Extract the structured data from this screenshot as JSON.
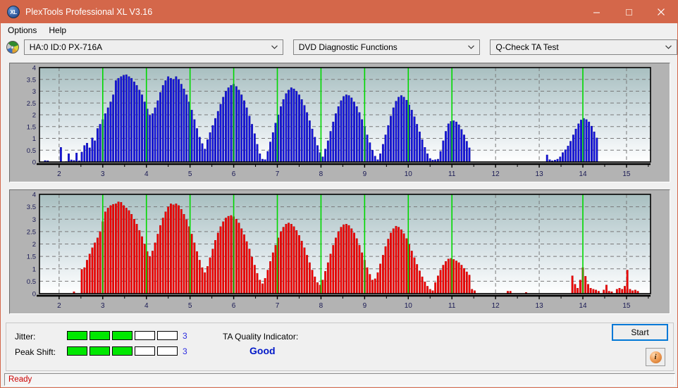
{
  "window": {
    "title": "PlexTools Professional XL V3.16",
    "icon": "XL",
    "accent_color": "#d4674a",
    "buttons": {
      "minimize": "—",
      "maximize": "☐",
      "close": "✕"
    }
  },
  "menubar": {
    "items": [
      {
        "label": "Options"
      },
      {
        "label": "Help"
      }
    ]
  },
  "toolbar": {
    "drive": {
      "value": "HA:0 ID:0  PX-716A",
      "icon": "disc-icon",
      "arrow": "⌄"
    },
    "function": {
      "value": "DVD Diagnostic Functions",
      "arrow": "⌄"
    },
    "test": {
      "value": "Q-Check TA Test",
      "arrow": "⌄"
    }
  },
  "results": {
    "jitter_label": "Jitter:",
    "jitter_value": "3",
    "jitter_filled": 3,
    "jitter_total": 5,
    "peak_shift_label": "Peak Shift:",
    "peak_shift_value": "3",
    "peak_shift_filled": 3,
    "peak_shift_total": 5,
    "ta_label": "TA Quality Indicator:",
    "ta_value": "Good",
    "ta_color": "#0018c8",
    "meter_on_color": "#00e800"
  },
  "actions": {
    "start_label": "Start",
    "info_label": "i"
  },
  "statusbar": {
    "text": "Ready"
  },
  "chart_data": [
    {
      "id": "jitter-chart",
      "type": "bar",
      "title": "",
      "xlabel": "",
      "ylabel": "",
      "series_color": "#1414dc",
      "bar_border_color": "#000080",
      "grid": true,
      "ylim": [
        0,
        4
      ],
      "yticks": [
        0,
        0.5,
        1,
        1.5,
        2,
        2.5,
        3,
        3.5,
        4
      ],
      "ytick_labels": [
        "0",
        "0.5",
        "1",
        "1.5",
        "2",
        "2.5",
        "3",
        "3.5",
        "4"
      ],
      "xlim": [
        1.55,
        15.55
      ],
      "xticks": [
        2,
        3,
        4,
        5,
        6,
        7,
        8,
        9,
        10,
        11,
        12,
        13,
        14,
        15
      ],
      "xtick_labels": [
        "2",
        "3",
        "4",
        "5",
        "6",
        "7",
        "8",
        "9",
        "10",
        "11",
        "12",
        "13",
        "14",
        "15"
      ],
      "marker_lines_x": [
        3,
        4,
        5,
        6,
        7,
        8,
        9,
        10,
        11,
        14
      ],
      "marker_color": "#00d800",
      "bar_x": [
        1.62,
        1.68,
        1.74,
        1.8,
        1.86,
        1.92,
        1.98,
        2.04,
        2.1,
        2.16,
        2.22,
        2.28,
        2.34,
        2.4,
        2.46,
        2.52,
        2.58,
        2.64,
        2.7,
        2.76,
        2.82,
        2.88,
        2.94,
        3.0,
        3.06,
        3.12,
        3.18,
        3.24,
        3.3,
        3.36,
        3.42,
        3.48,
        3.54,
        3.6,
        3.66,
        3.72,
        3.78,
        3.84,
        3.9,
        3.96,
        4.02,
        4.08,
        4.14,
        4.2,
        4.26,
        4.32,
        4.38,
        4.44,
        4.5,
        4.56,
        4.62,
        4.68,
        4.74,
        4.8,
        4.86,
        4.92,
        4.98,
        5.04,
        5.1,
        5.16,
        5.22,
        5.28,
        5.34,
        5.4,
        5.46,
        5.52,
        5.58,
        5.64,
        5.7,
        5.76,
        5.82,
        5.88,
        5.94,
        6.0,
        6.06,
        6.12,
        6.18,
        6.24,
        6.3,
        6.36,
        6.42,
        6.48,
        6.54,
        6.6,
        6.66,
        6.72,
        6.78,
        6.84,
        6.9,
        6.96,
        7.02,
        7.08,
        7.14,
        7.2,
        7.26,
        7.32,
        7.38,
        7.44,
        7.5,
        7.56,
        7.62,
        7.68,
        7.74,
        7.8,
        7.86,
        7.92,
        7.98,
        8.04,
        8.1,
        8.16,
        8.22,
        8.28,
        8.34,
        8.4,
        8.46,
        8.52,
        8.58,
        8.64,
        8.7,
        8.76,
        8.82,
        8.88,
        8.94,
        9.0,
        9.06,
        9.12,
        9.18,
        9.24,
        9.3,
        9.36,
        9.42,
        9.48,
        9.54,
        9.6,
        9.66,
        9.72,
        9.78,
        9.84,
        9.9,
        9.96,
        10.02,
        10.08,
        10.14,
        10.2,
        10.26,
        10.32,
        10.38,
        10.44,
        10.5,
        10.56,
        10.62,
        10.68,
        10.74,
        10.8,
        10.86,
        10.92,
        10.98,
        11.04,
        11.1,
        11.16,
        11.22,
        11.28,
        11.34,
        11.4,
        13.18,
        13.24,
        13.3,
        13.36,
        13.42,
        13.48,
        13.54,
        13.6,
        13.66,
        13.72,
        13.78,
        13.84,
        13.9,
        13.96,
        14.02,
        14.08,
        14.14,
        14.2,
        14.26,
        14.32
      ],
      "bar_y": [
        0.0,
        0.06,
        0.05,
        0.0,
        0.0,
        0.0,
        0.0,
        0.62,
        0.0,
        0.02,
        0.35,
        0.09,
        0.07,
        0.38,
        0.05,
        0.42,
        0.7,
        0.8,
        0.6,
        1.02,
        0.9,
        1.42,
        1.6,
        1.8,
        2.05,
        2.3,
        2.55,
        2.85,
        3.45,
        3.55,
        3.62,
        3.68,
        3.7,
        3.62,
        3.55,
        3.4,
        3.25,
        3.05,
        2.85,
        2.55,
        2.25,
        1.98,
        2.05,
        2.3,
        2.6,
        2.95,
        3.25,
        3.45,
        3.62,
        3.55,
        3.5,
        3.62,
        3.5,
        3.3,
        3.1,
        2.85,
        2.55,
        2.2,
        1.8,
        1.42,
        1.05,
        0.78,
        0.55,
        0.95,
        1.25,
        1.55,
        1.85,
        2.15,
        2.45,
        2.75,
        3.0,
        3.15,
        3.25,
        3.3,
        3.2,
        3.05,
        2.85,
        2.6,
        2.3,
        1.95,
        1.6,
        1.2,
        0.75,
        0.35,
        0.12,
        0.1,
        0.45,
        0.85,
        1.25,
        1.65,
        2.0,
        2.35,
        2.65,
        2.9,
        3.05,
        3.15,
        3.1,
        3.0,
        2.85,
        2.65,
        2.4,
        2.1,
        1.75,
        1.4,
        1.05,
        0.7,
        0.4,
        0.22,
        0.55,
        0.9,
        1.3,
        1.7,
        2.05,
        2.35,
        2.6,
        2.78,
        2.85,
        2.82,
        2.72,
        2.55,
        2.35,
        2.1,
        1.8,
        1.5,
        1.15,
        0.82,
        0.5,
        0.25,
        0.1,
        0.35,
        0.75,
        1.15,
        1.55,
        1.95,
        2.3,
        2.58,
        2.75,
        2.82,
        2.75,
        2.62,
        2.42,
        2.2,
        1.92,
        1.6,
        1.28,
        0.95,
        0.62,
        0.35,
        0.15,
        0.08,
        0.1,
        0.12,
        0.45,
        0.9,
        1.3,
        1.62,
        1.72,
        1.75,
        1.7,
        1.58,
        1.38,
        1.15,
        0.88,
        0.6,
        0.3,
        0.1,
        0.05,
        0.08,
        0.12,
        0.22,
        0.4,
        0.52,
        0.68,
        0.88,
        1.15,
        1.4,
        1.62,
        1.78,
        1.85,
        1.8,
        1.7,
        1.52,
        1.28,
        1.02,
        0.78,
        0.55
      ]
    },
    {
      "id": "peak-shift-chart",
      "type": "bar",
      "title": "",
      "xlabel": "",
      "ylabel": "",
      "series_color": "#f00000",
      "bar_border_color": "#a00000",
      "grid": true,
      "ylim": [
        0,
        4
      ],
      "yticks": [
        0,
        0.5,
        1,
        1.5,
        2,
        2.5,
        3,
        3.5,
        4
      ],
      "ytick_labels": [
        "0",
        "0.5",
        "1",
        "1.5",
        "2",
        "2.5",
        "3",
        "3.5",
        "4"
      ],
      "xlim": [
        1.55,
        15.55
      ],
      "xticks": [
        2,
        3,
        4,
        5,
        6,
        7,
        8,
        9,
        10,
        11,
        12,
        13,
        14,
        15
      ],
      "xtick_labels": [
        "2",
        "3",
        "4",
        "5",
        "6",
        "7",
        "8",
        "9",
        "10",
        "11",
        "12",
        "13",
        "14",
        "15"
      ],
      "marker_lines_x": [
        3,
        4,
        5,
        6,
        7,
        8,
        9,
        10,
        11,
        14
      ],
      "marker_color": "#00d800",
      "bar_x": [
        1.62,
        1.68,
        1.74,
        1.8,
        1.86,
        1.92,
        1.98,
        2.04,
        2.1,
        2.16,
        2.22,
        2.28,
        2.34,
        2.4,
        2.46,
        2.52,
        2.58,
        2.64,
        2.7,
        2.76,
        2.82,
        2.88,
        2.94,
        3.0,
        3.06,
        3.12,
        3.18,
        3.24,
        3.3,
        3.36,
        3.42,
        3.48,
        3.54,
        3.6,
        3.66,
        3.72,
        3.78,
        3.84,
        3.9,
        3.96,
        4.02,
        4.08,
        4.14,
        4.2,
        4.26,
        4.32,
        4.38,
        4.44,
        4.5,
        4.56,
        4.62,
        4.68,
        4.74,
        4.8,
        4.86,
        4.92,
        4.98,
        5.04,
        5.1,
        5.16,
        5.22,
        5.28,
        5.34,
        5.4,
        5.46,
        5.52,
        5.58,
        5.64,
        5.7,
        5.76,
        5.82,
        5.88,
        5.94,
        6.0,
        6.06,
        6.12,
        6.18,
        6.24,
        6.3,
        6.36,
        6.42,
        6.48,
        6.54,
        6.6,
        6.66,
        6.72,
        6.78,
        6.84,
        6.9,
        6.96,
        7.02,
        7.08,
        7.14,
        7.2,
        7.26,
        7.32,
        7.38,
        7.44,
        7.5,
        7.56,
        7.62,
        7.68,
        7.74,
        7.8,
        7.86,
        7.92,
        7.98,
        8.04,
        8.1,
        8.16,
        8.22,
        8.28,
        8.34,
        8.4,
        8.46,
        8.52,
        8.58,
        8.64,
        8.7,
        8.76,
        8.82,
        8.88,
        8.94,
        9.0,
        9.06,
        9.12,
        9.18,
        9.24,
        9.3,
        9.36,
        9.42,
        9.48,
        9.54,
        9.6,
        9.66,
        9.72,
        9.78,
        9.84,
        9.9,
        9.96,
        10.02,
        10.08,
        10.14,
        10.2,
        10.26,
        10.32,
        10.38,
        10.44,
        10.5,
        10.56,
        10.62,
        10.68,
        10.74,
        10.8,
        10.86,
        10.92,
        10.98,
        11.04,
        11.1,
        11.16,
        11.22,
        11.28,
        11.34,
        11.4,
        11.46,
        11.52,
        12.28,
        12.34,
        12.7,
        13.76,
        13.82,
        13.88,
        13.94,
        14.0,
        14.06,
        14.12,
        14.18,
        14.24,
        14.3,
        14.36,
        14.48,
        14.54,
        14.6,
        14.66,
        14.78,
        14.84,
        14.9,
        14.96,
        15.02,
        15.08,
        15.14,
        15.2,
        15.26
      ],
      "bar_y": [
        0.0,
        0.0,
        0.0,
        0.0,
        0.0,
        0.0,
        0.0,
        0.0,
        0.0,
        0.0,
        0.0,
        0.0,
        0.08,
        0.0,
        0.0,
        0.98,
        1.05,
        1.35,
        1.6,
        1.85,
        2.05,
        2.25,
        2.5,
        2.9,
        3.3,
        3.45,
        3.55,
        3.6,
        3.62,
        3.7,
        3.68,
        3.55,
        3.45,
        3.35,
        3.2,
        3.0,
        2.8,
        2.55,
        2.3,
        2.0,
        1.7,
        1.5,
        1.72,
        2.05,
        2.4,
        2.75,
        3.05,
        3.3,
        3.5,
        3.62,
        3.58,
        3.62,
        3.55,
        3.4,
        3.2,
        2.98,
        2.7,
        2.4,
        2.05,
        1.7,
        1.35,
        1.05,
        0.85,
        1.1,
        1.45,
        1.8,
        2.15,
        2.45,
        2.7,
        2.9,
        3.05,
        3.12,
        3.15,
        3.1,
        3.0,
        2.85,
        2.62,
        2.38,
        2.1,
        1.8,
        1.48,
        1.15,
        0.82,
        0.55,
        0.4,
        0.62,
        0.95,
        1.3,
        1.65,
        1.95,
        2.25,
        2.5,
        2.68,
        2.8,
        2.85,
        2.8,
        2.7,
        2.55,
        2.35,
        2.12,
        1.85,
        1.55,
        1.25,
        0.95,
        0.68,
        0.45,
        0.35,
        0.55,
        0.9,
        1.25,
        1.6,
        1.95,
        2.25,
        2.5,
        2.68,
        2.78,
        2.8,
        2.75,
        2.62,
        2.45,
        2.22,
        1.95,
        1.65,
        1.35,
        1.05,
        0.78,
        0.55,
        0.6,
        0.85,
        1.2,
        1.55,
        1.9,
        2.2,
        2.45,
        2.62,
        2.72,
        2.68,
        2.58,
        2.42,
        2.22,
        1.98,
        1.72,
        1.45,
        1.18,
        0.92,
        0.68,
        0.48,
        0.3,
        0.18,
        0.12,
        0.45,
        0.72,
        0.95,
        1.15,
        1.3,
        1.4,
        1.42,
        1.38,
        1.32,
        1.25,
        1.15,
        1.02,
        0.88,
        0.75,
        0.18,
        0.12,
        0.1,
        0.1,
        0.05,
        0.72,
        0.38,
        0.22,
        0.55,
        1.05,
        0.7,
        0.38,
        0.22,
        0.18,
        0.15,
        0.1,
        0.15,
        0.35,
        0.1,
        0.08,
        0.18,
        0.22,
        0.18,
        0.3,
        0.95,
        0.18,
        0.12,
        0.15,
        0.1
      ]
    }
  ]
}
